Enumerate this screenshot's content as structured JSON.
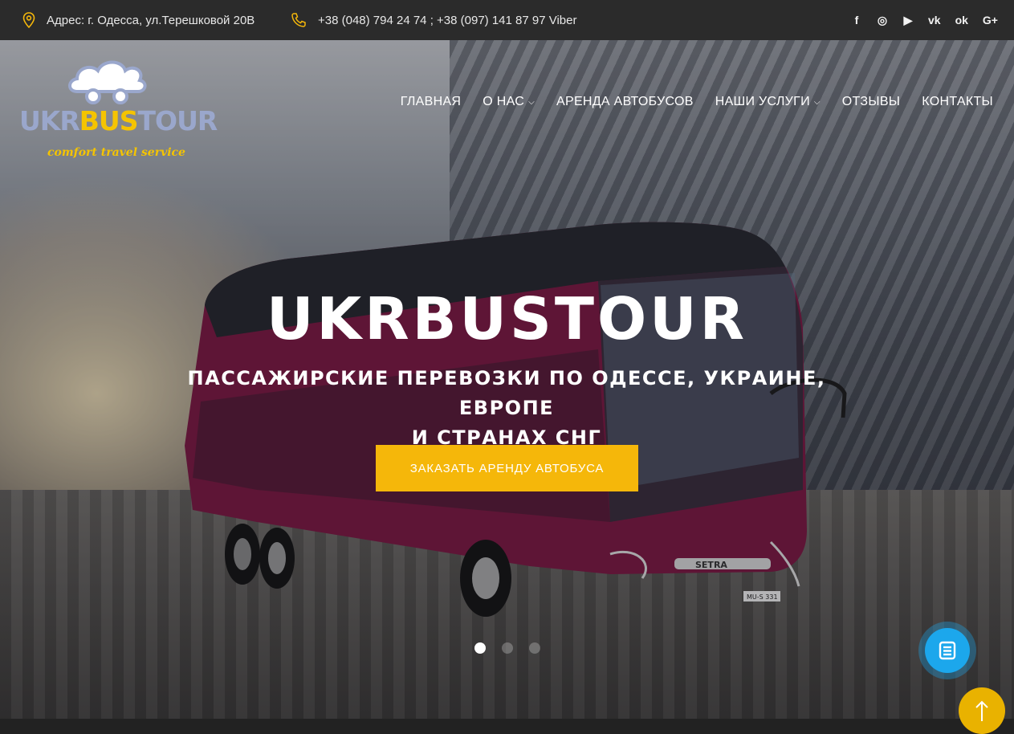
{
  "topbar": {
    "address": "Адрес: г. Одесса, ул.Терешковой 20В",
    "phone": "+38 (048) 794 24 74 ; +38 (097) 141 87 97 Viber",
    "social": {
      "facebook": "f",
      "instagram": "◎",
      "youtube": "▶",
      "vk": "vk",
      "odnoklassniki": "ok",
      "googleplus": "G+"
    }
  },
  "logo": {
    "part1": "UKR",
    "part2": "BUS",
    "part3": "TOUR",
    "tagline": "comfort travel service"
  },
  "nav": {
    "items": [
      {
        "label": "ГЛАВНАЯ"
      },
      {
        "label": "О НАС"
      },
      {
        "label": "АРЕНДА АВТОБУСОВ"
      },
      {
        "label": "НАШИ УСЛУГИ"
      },
      {
        "label": "ОТЗЫВЫ"
      },
      {
        "label": "КОНТАКТЫ"
      }
    ]
  },
  "hero": {
    "title": "UKRBUSTOUR",
    "subtitle_line1": "ПАССАЖИРСКИЕ ПЕРЕВОЗКИ ПО ОДЕССЕ, УКРАИНЕ, ЕВРОПЕ",
    "subtitle_line2": "И СТРАНАХ СНГ",
    "cta_label": "ЗАКАЗАТЬ АРЕНДУ АВТОБУСА",
    "bus_brand": "SETRA",
    "plate": "MU-S 331",
    "slides_total": 3,
    "slide_active": 1
  },
  "colors": {
    "accent": "#f5b70a",
    "topbar": "#2b2b2b",
    "float": "#1ca7ec",
    "logo_blue": "#9aa7cc",
    "logo_yellow": "#f5c400"
  },
  "icons": {
    "address": "map-pin-icon",
    "phone": "phone-icon",
    "float": "document-icon",
    "top": "arrow-up-icon"
  }
}
